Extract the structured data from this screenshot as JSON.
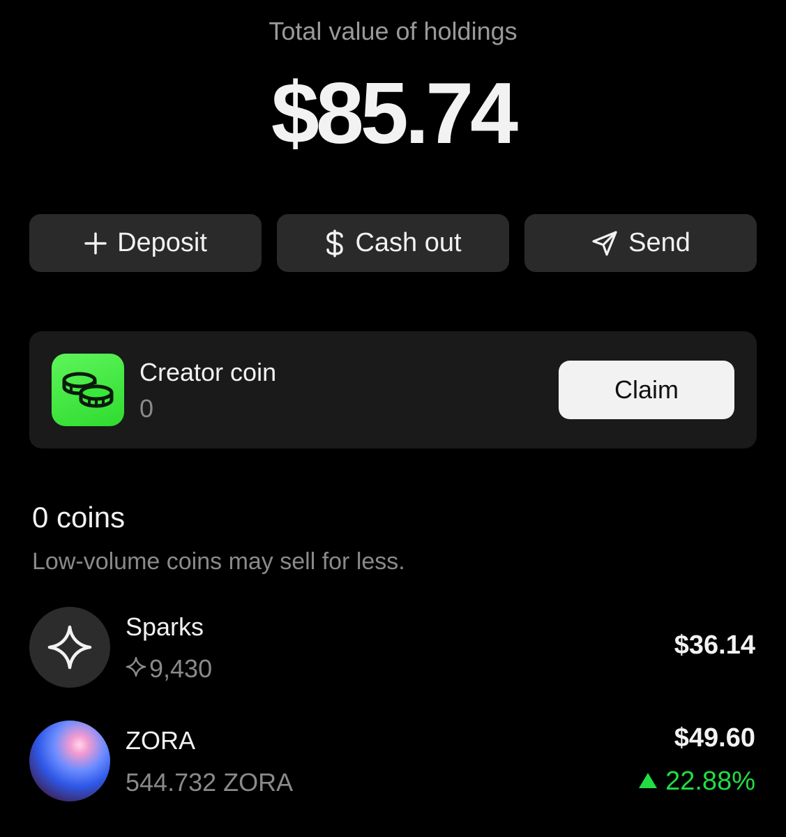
{
  "header": {
    "label": "Total value of holdings",
    "total": "$85.74"
  },
  "actions": {
    "deposit": {
      "label": "Deposit",
      "icon": "plus-icon"
    },
    "cash_out": {
      "label": "Cash out",
      "icon": "dollar-icon"
    },
    "send": {
      "label": "Send",
      "icon": "send-icon"
    }
  },
  "creator_coin": {
    "title": "Creator coin",
    "count": "0",
    "icon": "coins-icon",
    "icon_color": "#39e63a",
    "claim_label": "Claim"
  },
  "coins_section": {
    "title": "0 coins",
    "subtitle": "Low-volume coins may sell for less."
  },
  "coins": [
    {
      "name": "Sparks",
      "amount": "9,430",
      "amount_icon": "sparkle-icon",
      "value": "$36.14",
      "avatar_icon": "sparkle-icon"
    },
    {
      "name": "ZORA",
      "amount": "544.732 ZORA",
      "value": "$49.60",
      "change": "22.88%",
      "change_direction": "up",
      "change_color": "#22dd44"
    }
  ]
}
